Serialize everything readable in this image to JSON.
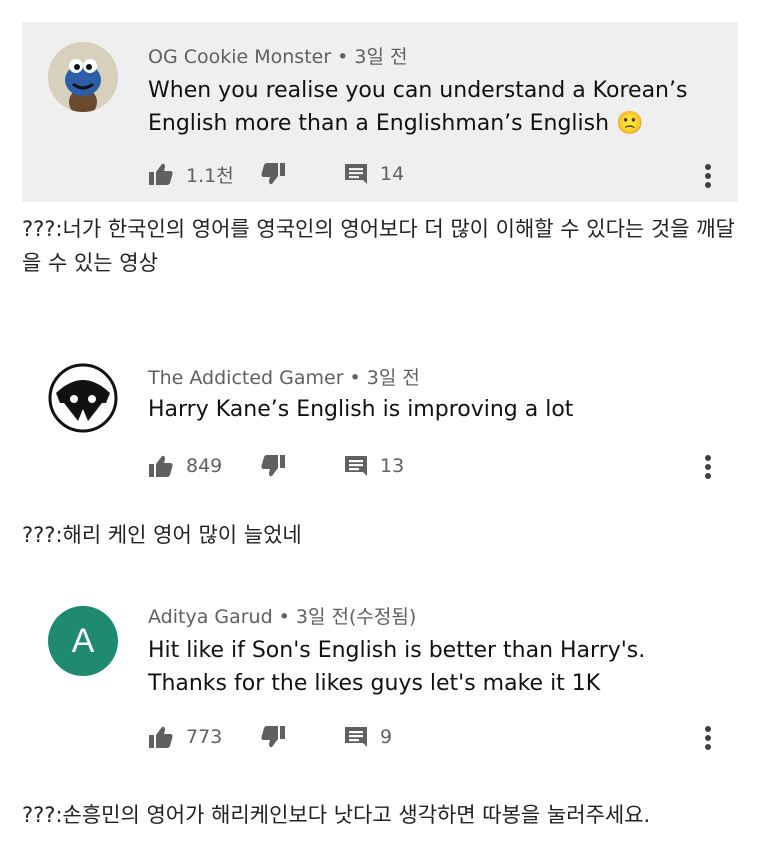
{
  "comments": [
    {
      "author": "OG Cookie Monster",
      "time": "3일 전",
      "text_lines": [
        "When you realise you can understand a Korean’s",
        "English more than a Englishman’s English 🙁"
      ],
      "likes": "1.1천",
      "replies": "14",
      "translation": "???:너가 한국인의 영어를 영국인의 영어보다 더 많이 이해할 수 있다는 것을 깨달을 수 있는 영상"
    },
    {
      "author": "The Addicted Gamer",
      "time": "3일 전",
      "text_lines": [
        "Harry Kane’s English is improving a lot"
      ],
      "likes": "849",
      "replies": "13",
      "translation": "???:해리 케인 영어 많이 늘었네"
    },
    {
      "author": "Aditya Garud",
      "time": "3일 전(수정됨)",
      "avatar_letter": "A",
      "text_lines": [
        "Hit like if Son's English is better than Harry's.",
        "Thanks for the likes guys let's make it 1K"
      ],
      "likes": "773",
      "replies": "9",
      "translation": "???:손흥민의 영어가 해리케인보다 낫다고 생각하면 따봉을 눌러주세요."
    }
  ],
  "icons": {
    "like": "thumbs-up-icon",
    "dislike": "thumbs-down-icon",
    "reply": "comment-icon",
    "more": "more-vert-icon"
  },
  "colors": {
    "highlight_bg": "#efefef",
    "avatar_green": "#1f8a70",
    "meta_gray": "#606060"
  }
}
